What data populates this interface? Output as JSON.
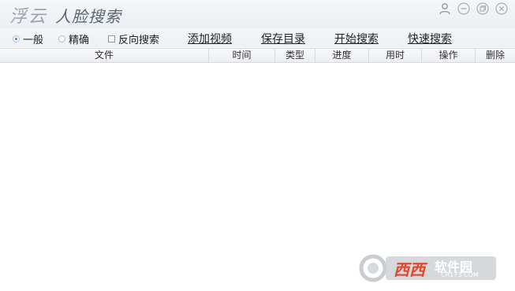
{
  "app": {
    "title_main": "浮云",
    "title_sub": "人脸搜索"
  },
  "window_controls": [
    "user-icon",
    "minimize-icon",
    "restore-icon",
    "close-icon"
  ],
  "search_options": {
    "mode_normal": "一般",
    "mode_precise": "精确",
    "selected_mode": "一般",
    "reverse_search": "反向搜索",
    "reverse_checked": false
  },
  "actions": {
    "add_video": "添加视频",
    "save_dir": "保存目录",
    "start_search": "开始搜索",
    "quick_search": "快速搜索"
  },
  "table": {
    "columns": [
      "文件",
      "时间",
      "类型",
      "进度",
      "用时",
      "操作",
      "删除"
    ],
    "rows": []
  },
  "watermark": {
    "text1": "西西",
    "text2": "软件园",
    "url": "CR173.COM"
  },
  "colors": {
    "accent": "#3f7fd6",
    "titlebar": "#eef1f4",
    "watermark_red": "#e2462b"
  }
}
